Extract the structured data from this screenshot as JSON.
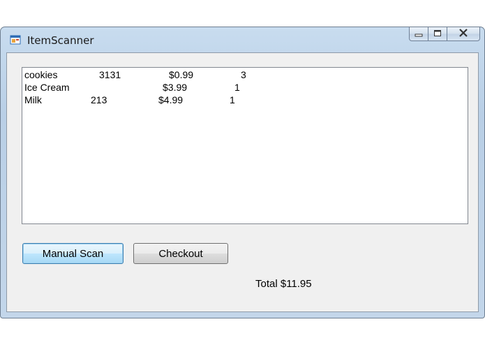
{
  "window": {
    "title": "ItemScanner",
    "controls": {
      "minimize": "—",
      "maximize": "▭",
      "close": "✕"
    }
  },
  "items": [
    {
      "name": "cookies",
      "code": "3131",
      "price": "$0.99",
      "qty": "3"
    },
    {
      "name": "Ice Cream",
      "code": "",
      "price": "$3.99",
      "qty": "1"
    },
    {
      "name": "Milk",
      "code": "213",
      "price": "$4.99",
      "qty": "1"
    }
  ],
  "buttons": {
    "manual_scan": "Manual Scan",
    "checkout": "Checkout"
  },
  "total_label": "Total $11.95",
  "colors": {
    "focus_border": "#3c7fb1",
    "list_border": "#828790",
    "client_bg": "#f0f0f0"
  }
}
